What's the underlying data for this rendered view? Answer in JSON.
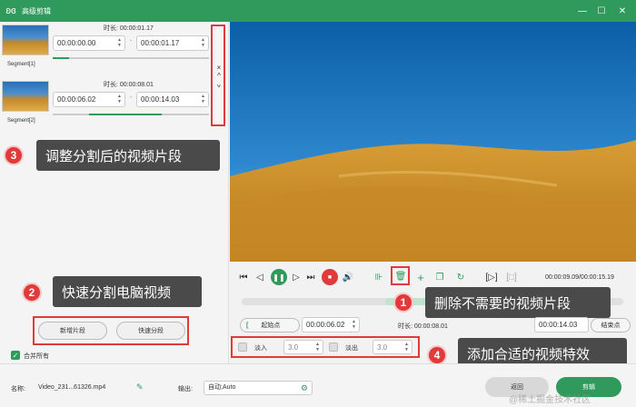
{
  "window": {
    "title": "高级剪辑",
    "app_icon": "ms-icon"
  },
  "segments": [
    {
      "label": "Segment[1]",
      "duration": "时长: 00:00:01.17",
      "start": "00:00:00.00",
      "end": "00:00:01.17"
    },
    {
      "label": "Segment[2]",
      "duration": "时长: 00:00:08.01",
      "start": "00:00:06.02",
      "end": "00:00:14.03"
    }
  ],
  "collapse_strip": {
    "close": "×",
    "up": "^",
    "down": "^"
  },
  "annotations": [
    {
      "number": "1",
      "text": "删除不需要的视频片段"
    },
    {
      "number": "2",
      "text": "快速分割电脑视频"
    },
    {
      "number": "3",
      "text": "调整分割后的视频片段"
    },
    {
      "number": "4",
      "text": "添加合适的视频特效"
    }
  ],
  "left_buttons": {
    "new_segment": "新增片段",
    "quick_split": "快速分段"
  },
  "merge_all": {
    "label": "合并所有",
    "checked": true
  },
  "playback": {
    "time": "00:00:09.09/00:00:15.19"
  },
  "trim": {
    "start_label": "起始点",
    "start_value": "00:00:06.02",
    "duration": "时长: 00:00:08.01",
    "end_value": "00:00:14.03",
    "end_label": "结束点"
  },
  "effects": {
    "fade_in_label": "淡入",
    "fade_in_value": "3.0",
    "fade_out_label": "淡出",
    "fade_out_value": "3.0"
  },
  "footer": {
    "name_label": "名称:",
    "name_value": "Video_231...61326.mp4",
    "output_label": "输出:",
    "output_value": "自动;Auto",
    "back_button": "返回",
    "cut_button": "剪辑",
    "watermark": "@稀土掘金技术社区"
  },
  "colors": {
    "accent": "#2f9a5c",
    "annotation": "#e03a3a",
    "callout_bg": "#4a4a4a",
    "record": "#e03a3a"
  }
}
